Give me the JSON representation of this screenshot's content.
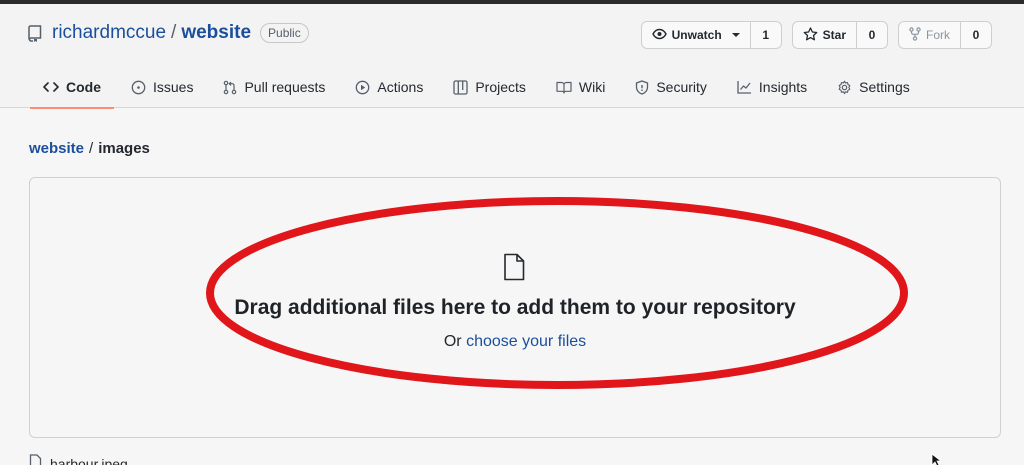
{
  "repo": {
    "owner": "richardmccue",
    "separator": "/",
    "name": "website",
    "visibility": "Public"
  },
  "actions": {
    "watch": {
      "label": "Unwatch",
      "count": "1"
    },
    "star": {
      "label": "Star",
      "count": "0"
    },
    "fork": {
      "label": "Fork",
      "count": "0"
    }
  },
  "tabs": [
    {
      "label": "Code",
      "icon": "code-icon",
      "active": true
    },
    {
      "label": "Issues",
      "icon": "issue-icon"
    },
    {
      "label": "Pull requests",
      "icon": "pull-request-icon"
    },
    {
      "label": "Actions",
      "icon": "play-icon"
    },
    {
      "label": "Projects",
      "icon": "table-icon"
    },
    {
      "label": "Wiki",
      "icon": "book-icon"
    },
    {
      "label": "Security",
      "icon": "shield-icon"
    },
    {
      "label": "Insights",
      "icon": "graph-icon"
    },
    {
      "label": "Settings",
      "icon": "gear-icon"
    }
  ],
  "breadcrumb": {
    "repo": "website",
    "separator": "/",
    "directory": "images"
  },
  "dropzone": {
    "title": "Drag additional files here to add them to your repository",
    "prefix": "Or",
    "link": "choose your files"
  },
  "files": [
    {
      "name": "harbour.jpeg"
    }
  ],
  "colors": {
    "link": "#1b4f9c",
    "annotation": "#e0161a",
    "active_tab_underline": "#fd8c73"
  }
}
